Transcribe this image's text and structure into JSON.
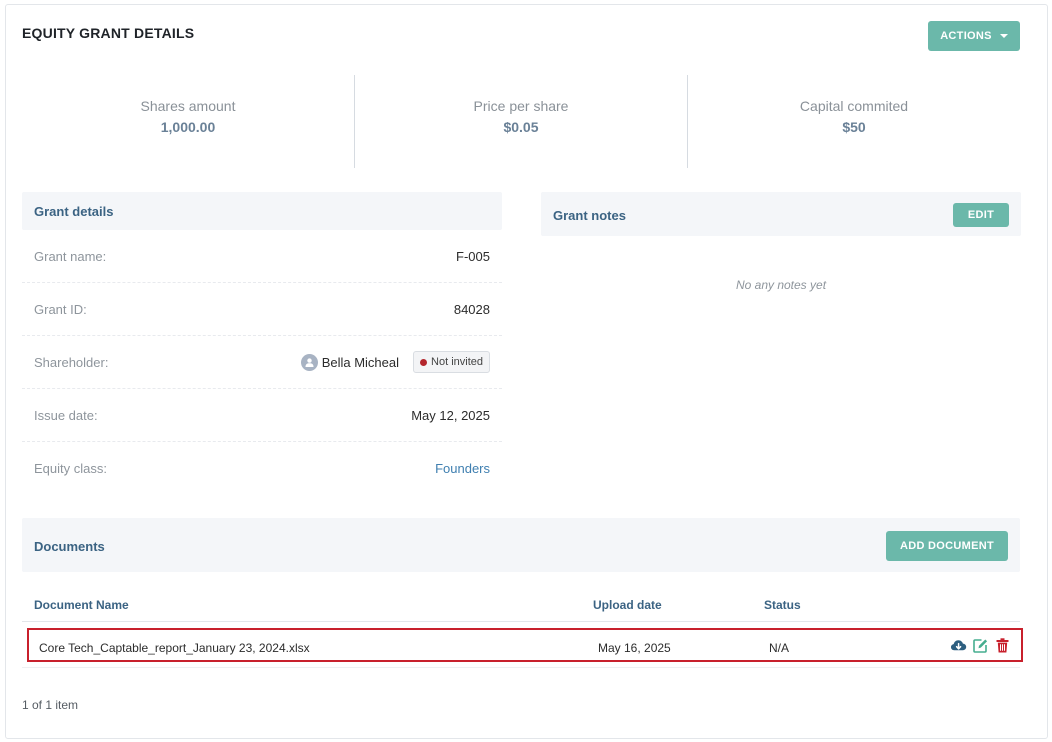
{
  "header": {
    "title": "EQUITY GRANT DETAILS",
    "actions_label": "ACTIONS"
  },
  "stats": [
    {
      "label": "Shares amount",
      "value": "1,000.00"
    },
    {
      "label": "Price per share",
      "value": "$0.05"
    },
    {
      "label": "Capital commited",
      "value": "$50"
    }
  ],
  "grant_details": {
    "title": "Grant details",
    "rows": {
      "grant_name": {
        "label": "Grant name:",
        "value": "F-005"
      },
      "grant_id": {
        "label": "Grant ID:",
        "value": "84028"
      },
      "shareholder": {
        "label": "Shareholder:",
        "name": "Bella Micheal",
        "status": "Not invited"
      },
      "issue_date": {
        "label": "Issue date:",
        "value": "May 12, 2025"
      },
      "equity_class": {
        "label": "Equity class:",
        "value": "Founders"
      }
    }
  },
  "grant_notes": {
    "title": "Grant notes",
    "edit_label": "EDIT",
    "empty_text": "No any notes yet"
  },
  "documents": {
    "title": "Documents",
    "add_label": "ADD DOCUMENT",
    "columns": [
      "Document Name",
      "Upload date",
      "Status"
    ],
    "rows": [
      {
        "name": "Core Tech_Captable_report_January 23, 2024.xlsx",
        "upload_date": "May 16, 2025",
        "status": "N/A"
      }
    ],
    "pagination": "1 of 1 item"
  },
  "icons": {
    "download": "cloud-download-icon",
    "edit": "edit-icon",
    "delete": "trash-icon"
  },
  "colors": {
    "accent": "#6bb8aa",
    "heading": "#3b6383",
    "link": "#3f7fb0",
    "danger": "#c8202c",
    "highlight_border": "#c8202c"
  }
}
